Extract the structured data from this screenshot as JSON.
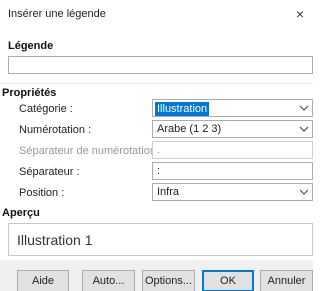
{
  "window": {
    "title": "Insérer une légende",
    "close_glyph": "×"
  },
  "legende": {
    "heading": "Légende",
    "value": ""
  },
  "proprietes": {
    "heading": "Propriétés",
    "categorie": {
      "label": "Catégorie :",
      "value": "Illustration"
    },
    "numerotation": {
      "label": "Numérotation :",
      "value": "Arabe (1 2 3)"
    },
    "separateur_numerotation": {
      "label": "Séparateur de numérotation :",
      "value": "."
    },
    "separateur": {
      "label": "Séparateur :",
      "value": ":"
    },
    "position": {
      "label": "Position :",
      "value": "Infra"
    }
  },
  "apercu": {
    "heading": "Aperçu",
    "text": "Illustration 1"
  },
  "buttons": {
    "aide": "Aide",
    "auto": "Auto...",
    "options": "Options...",
    "ok": "OK",
    "annuler": "Annuler"
  },
  "icons": {
    "dropdown": "chevron-down-icon",
    "close": "close-icon"
  }
}
